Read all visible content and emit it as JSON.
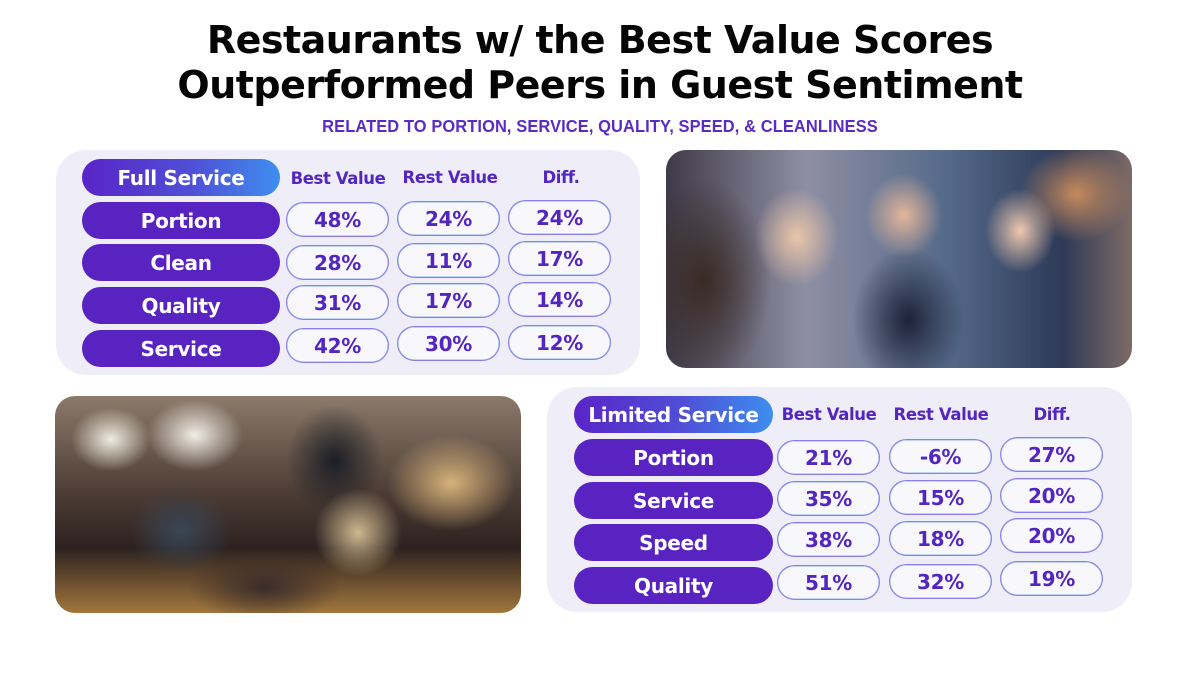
{
  "header": {
    "title_line1": "Restaurants w/ the Best Value Scores",
    "title_line2": "Outperformed Peers in Guest Sentiment",
    "subtitle": "RELATED TO PORTION, SERVICE, QUALITY, SPEED, & CLEANLINESS"
  },
  "colors": {
    "accent_purple": "#5923c2",
    "gradient_end_blue": "#3e8ef0",
    "panel_bg": "#efeef8",
    "value_text": "#5326c0"
  },
  "full_service": {
    "segment_label": "Full Service",
    "columns": [
      "Best Value",
      "Rest Value",
      "Diff."
    ],
    "rows": [
      {
        "label": "Portion",
        "best_value": "48%",
        "rest_value": "24%",
        "diff": "24%"
      },
      {
        "label": "Clean",
        "best_value": "28%",
        "rest_value": "11%",
        "diff": "17%"
      },
      {
        "label": "Quality",
        "best_value": "31%",
        "rest_value": "17%",
        "diff": "14%"
      },
      {
        "label": "Service",
        "best_value": "42%",
        "rest_value": "30%",
        "diff": "12%"
      }
    ]
  },
  "limited_service": {
    "segment_label": "Limited Service",
    "columns": [
      "Best Value",
      "Rest Value",
      "Diff."
    ],
    "rows": [
      {
        "label": "Portion",
        "best_value": "21%",
        "rest_value": "-6%",
        "diff": "27%"
      },
      {
        "label": "Service",
        "best_value": "35%",
        "rest_value": "15%",
        "diff": "20%"
      },
      {
        "label": "Speed",
        "best_value": "38%",
        "rest_value": "18%",
        "diff": "20%"
      },
      {
        "label": "Quality",
        "best_value": "51%",
        "rest_value": "32%",
        "diff": "19%"
      }
    ]
  },
  "photos": {
    "top_right": "Friends laughing together at a restaurant table with drinks",
    "bottom_left": "Server handing menus to guests at a round table in a restaurant"
  }
}
